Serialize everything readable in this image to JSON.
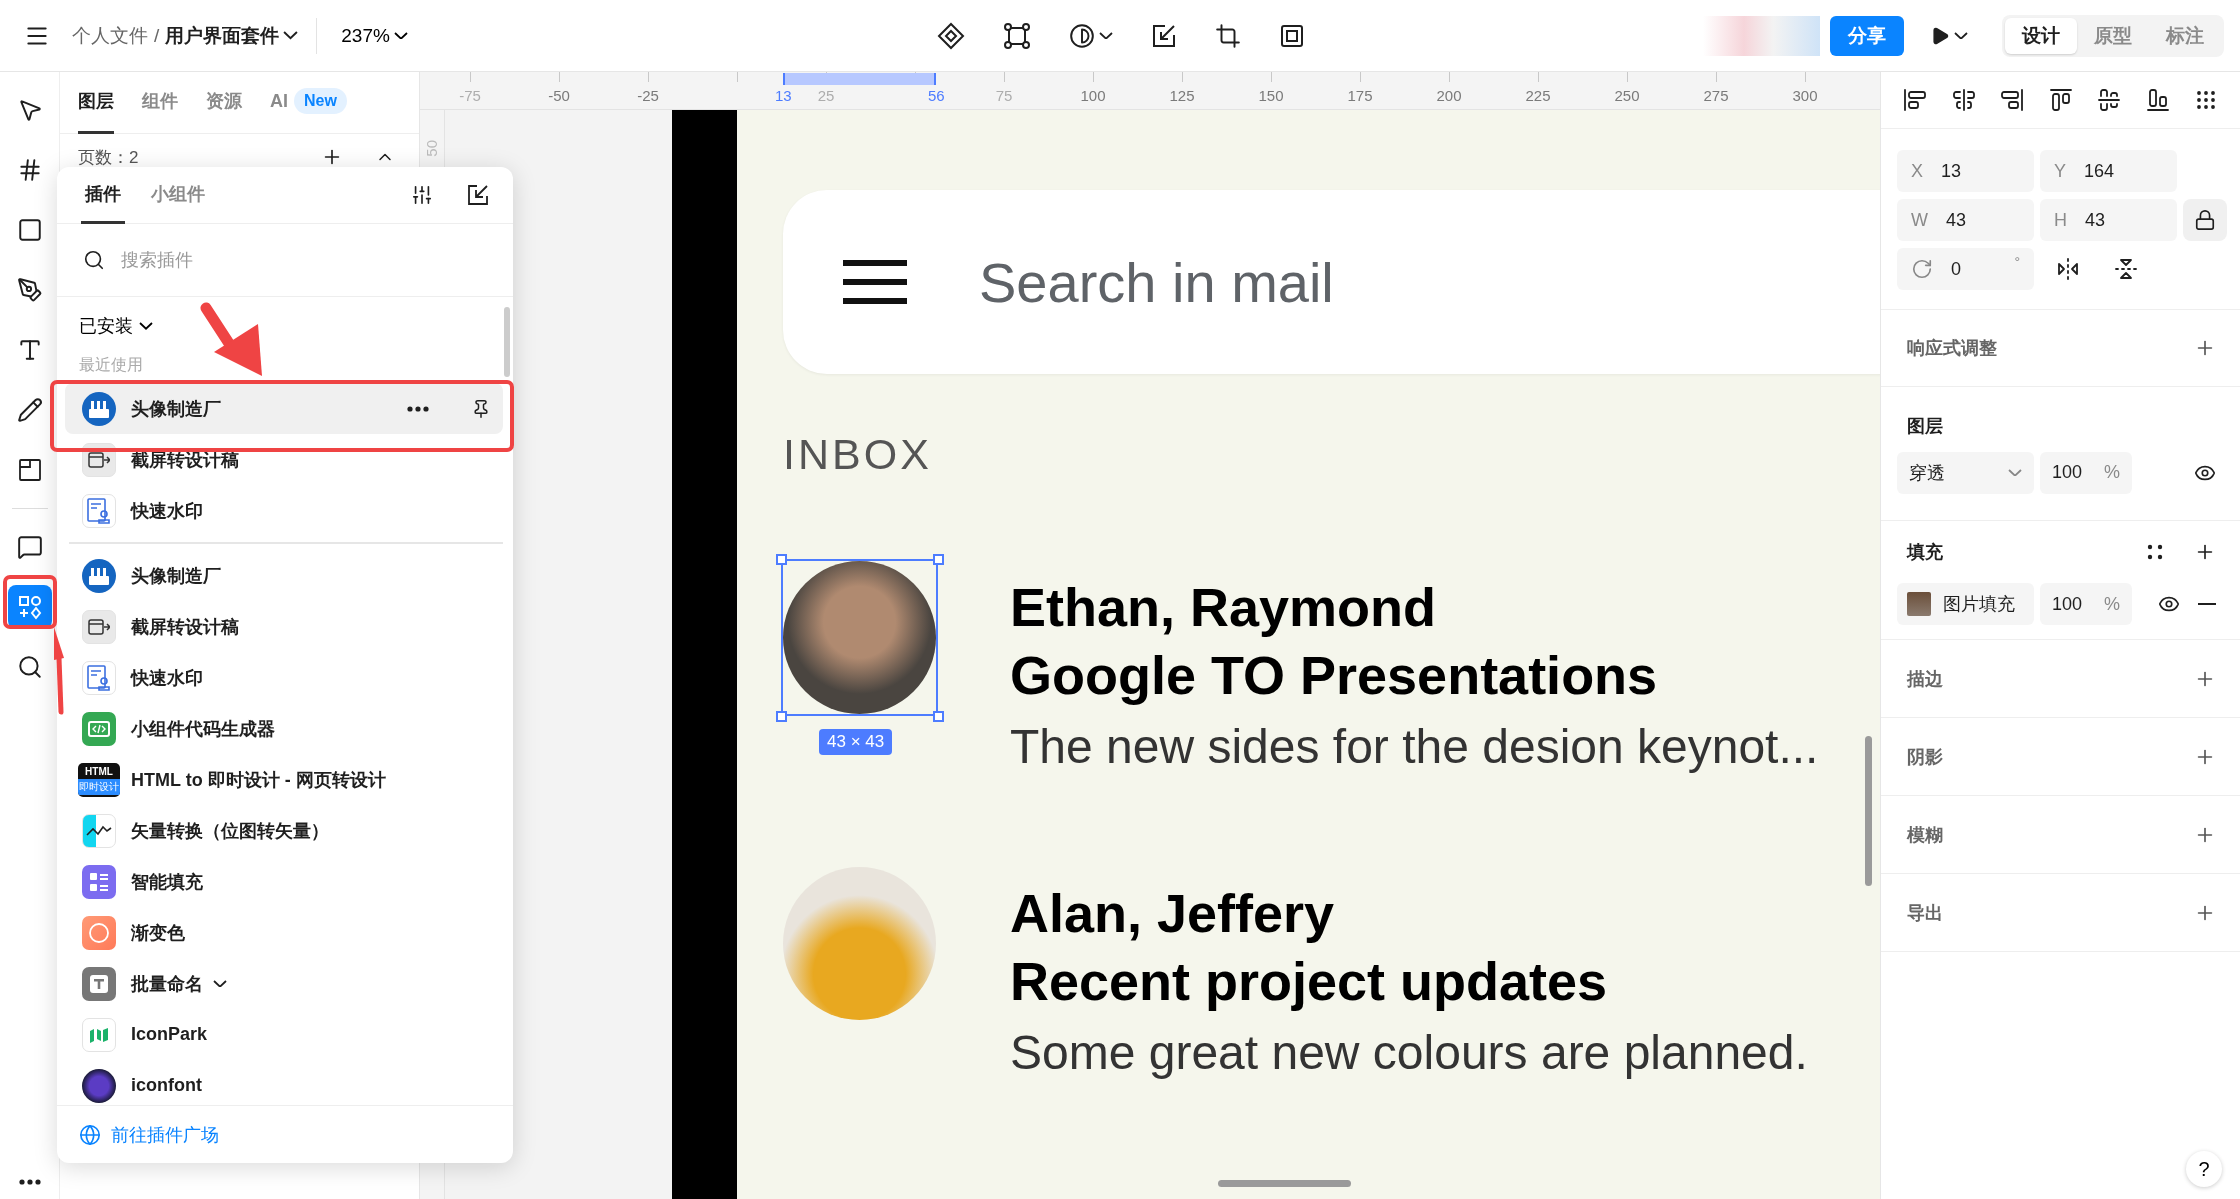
{
  "topbar": {
    "breadcrumb_parent": "个人文件",
    "breadcrumb_separator": "/",
    "file_name": "用户界面套件",
    "zoom": "237%",
    "share_label": "分享",
    "modes": [
      {
        "label": "设计",
        "selected": true
      },
      {
        "label": "原型",
        "selected": false
      },
      {
        "label": "标注",
        "selected": false
      }
    ]
  },
  "toolbar": {
    "groups": [
      {
        "tools": [
          {
            "kind": "move",
            "selected": false
          },
          {
            "kind": "frame",
            "selected": false
          },
          {
            "kind": "shape",
            "selected": false
          },
          {
            "kind": "pen",
            "selected": false
          },
          {
            "kind": "text",
            "selected": false
          },
          {
            "kind": "pencil",
            "selected": false
          },
          {
            "kind": "section",
            "selected": false
          }
        ]
      },
      {
        "tools": [
          {
            "kind": "comment",
            "selected": false
          },
          {
            "kind": "plugins",
            "selected": true
          },
          {
            "kind": "search",
            "selected": false
          }
        ]
      }
    ]
  },
  "layers_panel": {
    "tabs": [
      {
        "label": "图层",
        "selected": true
      },
      {
        "label": "组件",
        "selected": false
      },
      {
        "label": "资源",
        "selected": false
      },
      {
        "label": "AI",
        "selected": false,
        "badge": "New"
      }
    ],
    "pages_label": "页数：2"
  },
  "plugin_popup": {
    "tabs": [
      {
        "label": "插件",
        "selected": true
      },
      {
        "label": "小组件",
        "selected": false
      }
    ],
    "search_placeholder": "搜索插件",
    "filter": "已安装",
    "recent_heading": "最近使用",
    "recent": [
      {
        "name": "头像制造厂",
        "kind": "factory",
        "hovered": true,
        "has_menu": false
      },
      {
        "name": "截屏转设计稿",
        "kind": "screenshot",
        "hovered": false,
        "has_menu": false
      },
      {
        "name": "快速水印",
        "kind": "watermark",
        "hovered": false,
        "has_menu": false
      }
    ],
    "plugins": [
      {
        "name": "头像制造厂",
        "kind": "factory",
        "hovered": false,
        "has_menu": false
      },
      {
        "name": "截屏转设计稿",
        "kind": "screenshot",
        "hovered": false,
        "has_menu": false
      },
      {
        "name": "快速水印",
        "kind": "watermark",
        "hovered": false,
        "has_menu": false
      },
      {
        "name": "小组件代码生成器",
        "kind": "code",
        "hovered": false,
        "has_menu": false
      },
      {
        "name": "HTML to 即时设计 - 网页转设计",
        "kind": "html",
        "icon_text": [
          "HTML",
          "即时设计"
        ],
        "hovered": false,
        "has_menu": false
      },
      {
        "name": "矢量转换（位图转矢量）",
        "kind": "vector",
        "hovered": false,
        "has_menu": false
      },
      {
        "name": "智能填充",
        "kind": "fill",
        "hovered": false,
        "has_menu": false
      },
      {
        "name": "渐变色",
        "kind": "gradient",
        "hovered": false,
        "has_menu": false
      },
      {
        "name": "批量命名",
        "kind": "rename",
        "hovered": false,
        "has_menu": true
      },
      {
        "name": "IconPark",
        "kind": "iconpark",
        "hovered": false,
        "has_menu": false
      },
      {
        "name": "iconfont",
        "kind": "iconfont",
        "hovered": false,
        "has_menu": false
      }
    ],
    "footer_link": "前往插件广场"
  },
  "ruler": {
    "ticks": [
      {
        "label": "-75",
        "kind": "dim"
      },
      {
        "label": "-50",
        "kind": "normal"
      },
      {
        "label": "-25",
        "kind": "normal"
      },
      {
        "label": "13",
        "kind": "selection"
      },
      {
        "label": "25",
        "kind": "dim"
      },
      {
        "label": "56",
        "kind": "selection"
      },
      {
        "label": "75",
        "kind": "dim"
      },
      {
        "label": "100",
        "kind": "normal"
      },
      {
        "label": "125",
        "kind": "normal"
      },
      {
        "label": "150",
        "kind": "normal"
      },
      {
        "label": "175",
        "kind": "normal"
      },
      {
        "label": "200",
        "kind": "normal"
      },
      {
        "label": "225",
        "kind": "normal"
      },
      {
        "label": "250",
        "kind": "normal"
      },
      {
        "label": "275",
        "kind": "normal"
      },
      {
        "label": "300",
        "kind": "normal"
      }
    ],
    "side_label": "50"
  },
  "canvas": {
    "search_text": "Search in mail",
    "section_title": "INBOX",
    "selection_size": "43 × 43",
    "emails": [
      {
        "sender": "Ethan, Raymond",
        "subject": "Google TO Presentations",
        "preview": "The new sides for the desion keynot...",
        "selected": true
      },
      {
        "sender": "Alan, Jeffery",
        "subject": "Recent project updates",
        "preview": "Some great new colours are planned.",
        "selected": false
      }
    ]
  },
  "inspector": {
    "fields": [
      {
        "label": "X",
        "value": "13"
      },
      {
        "label": "Y",
        "value": "164"
      },
      {
        "label": "W",
        "value": "43"
      },
      {
        "label": "H",
        "value": "43"
      }
    ],
    "rotation": {
      "value": "0",
      "unit": "°"
    },
    "responsive_heading": "响应式调整",
    "layer": {
      "heading": "图层",
      "blend": "穿透",
      "opacity": "100",
      "unit": "%"
    },
    "fill": {
      "heading": "填充",
      "type": "图片填充",
      "opacity": "100",
      "unit": "%"
    },
    "sections": [
      "描边",
      "阴影",
      "模糊",
      "导出"
    ],
    "help": "?"
  }
}
